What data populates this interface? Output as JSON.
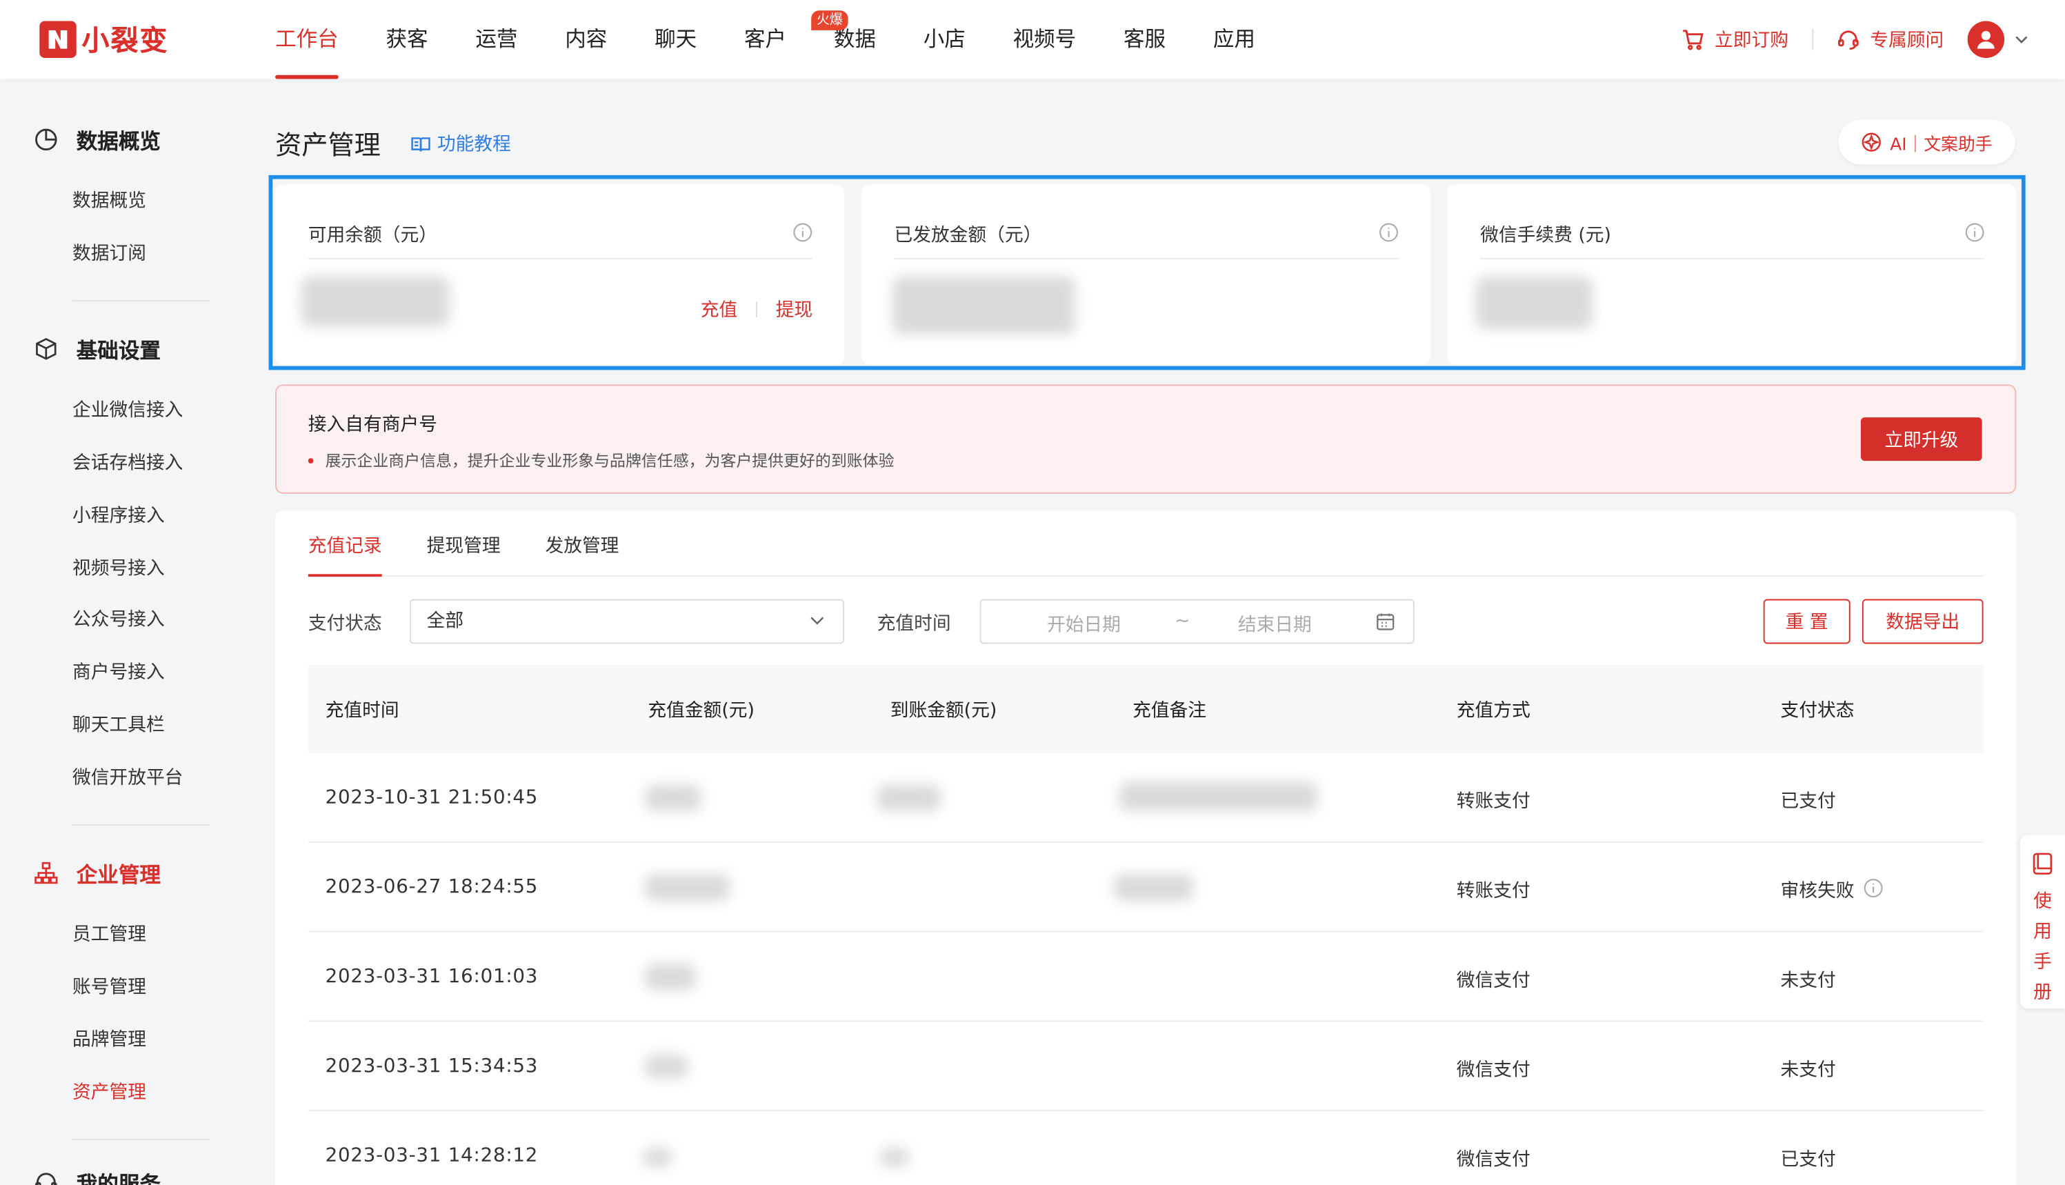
{
  "brand": {
    "name": "小裂变",
    "color": "#d9302c"
  },
  "nav": {
    "items": [
      "工作台",
      "获客",
      "运营",
      "内容",
      "聊天",
      "客户",
      "数据",
      "小店",
      "视频号",
      "客服",
      "应用"
    ],
    "badge": "火爆",
    "order_label": "立即订购",
    "consultant_label": "专属顾问"
  },
  "sidebar": {
    "groups": [
      {
        "title": "数据概览",
        "icon": "pie-chart-icon",
        "items": [
          "数据概览",
          "数据订阅"
        ]
      },
      {
        "title": "基础设置",
        "icon": "cube-icon",
        "items": [
          "企业微信接入",
          "会话存档接入",
          "小程序接入",
          "视频号接入",
          "公众号接入",
          "商户号接入",
          "聊天工具栏",
          "微信开放平台"
        ]
      },
      {
        "title": "企业管理",
        "icon": "org-chart-icon",
        "items": [
          "员工管理",
          "账号管理",
          "品牌管理",
          "资产管理"
        ]
      },
      {
        "title": "我的服务",
        "icon": "service-icon"
      }
    ],
    "active_item": "资产管理"
  },
  "page": {
    "title": "资产管理",
    "tutorial_label": "功能教程",
    "ai_label": "AI｜文案助手"
  },
  "cards": [
    {
      "title": "可用余额（元）",
      "actions": [
        "充值",
        "提现"
      ]
    },
    {
      "title": "已发放金额（元）"
    },
    {
      "title": "微信手续费 (元)"
    }
  ],
  "banner": {
    "title": "接入自有商户号",
    "desc": "展示企业商户信息，提升企业专业形象与品牌信任感，为客户提供更好的到账体验",
    "button": "立即升级"
  },
  "tabs": [
    "充值记录",
    "提现管理",
    "发放管理"
  ],
  "filters": {
    "status_label": "支付状态",
    "status_value": "全部",
    "time_label": "充值时间",
    "start_placeholder": "开始日期",
    "range_sep": "~",
    "end_placeholder": "结束日期",
    "reset": "重 置",
    "export": "数据导出"
  },
  "table": {
    "columns": [
      "充值时间",
      "充值金额(元)",
      "到账金额(元)",
      "充值备注",
      "充值方式",
      "支付状态"
    ],
    "rows": [
      {
        "time": "2023-10-31 21:50:45",
        "method": "转账支付",
        "status": "已支付"
      },
      {
        "time": "2023-06-27 18:24:55",
        "method": "转账支付",
        "status": "审核失败"
      },
      {
        "time": "2023-03-31 16:01:03",
        "method": "微信支付",
        "status": "未支付"
      },
      {
        "time": "2023-03-31 15:34:53",
        "method": "微信支付",
        "status": "未支付"
      },
      {
        "time": "2023-03-31 14:28:12",
        "method": "微信支付",
        "status": "已支付"
      }
    ]
  },
  "manual": {
    "label": "使用手册"
  },
  "colors": {
    "accent": "#d9302c",
    "link": "#2f7de1",
    "highlight": "#1e8ee9"
  }
}
